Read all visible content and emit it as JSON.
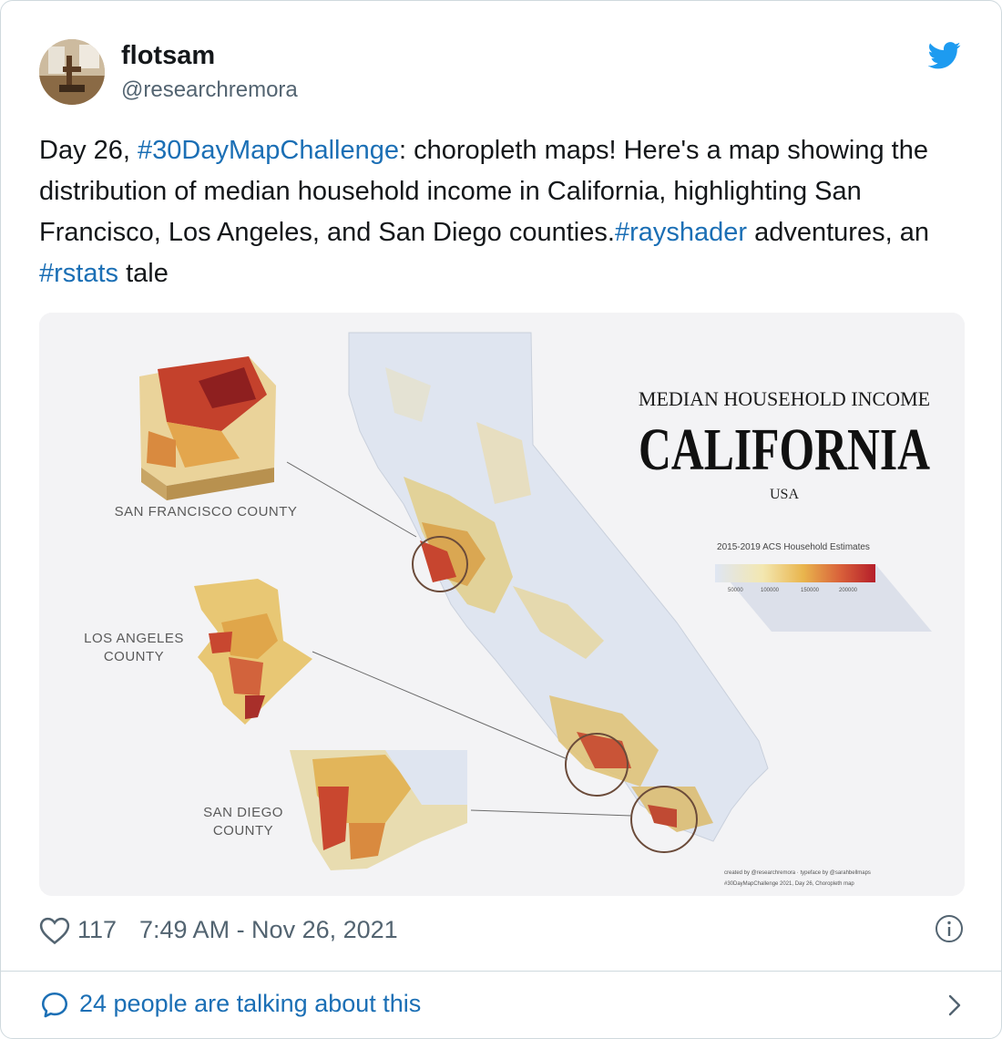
{
  "user": {
    "display_name": "flotsam",
    "handle": "@researchremora"
  },
  "tweet": {
    "segments": [
      {
        "text": "Day 26, ",
        "link": false
      },
      {
        "text": "#30DayMapChallenge",
        "link": true
      },
      {
        "text": ": choropleth maps! Here's a map showing the distribution of median household income in California, highlighting San Francisco, Los Angeles, and San Diego counties.",
        "link": false
      },
      {
        "text": "#rayshader",
        "link": true
      },
      {
        "text": " adventures, an ",
        "link": false
      },
      {
        "text": "#rstats",
        "link": true
      },
      {
        "text": " tale",
        "link": false
      }
    ]
  },
  "map": {
    "title_top": "MEDIAN HOUSEHOLD INCOME",
    "title_main": "CALIFORNIA",
    "title_sub": "USA",
    "legend_title": "2015-2019 ACS Household Estimates",
    "legend_ticks": [
      "50000",
      "100000",
      "150000",
      "200000"
    ],
    "legend_colors": [
      "#dfe6f3",
      "#f3e7b0",
      "#e9b54d",
      "#d9613a",
      "#b51e2a"
    ],
    "labels": {
      "sf": "SAN FRANCISCO COUNTY",
      "la_line1": "LOS ANGELES",
      "la_line2": "COUNTY",
      "sd_line1": "SAN DIEGO",
      "sd_line2": "COUNTY"
    },
    "credit_line1": "created by @researchremora · typeface by @sarahbellmaps",
    "credit_line2": "#30DayMapChallenge 2021, Day 26, Choropleth map"
  },
  "footer": {
    "likes": "117",
    "timestamp": "7:49 AM - Nov 26, 2021",
    "talking": "24 people are talking about this"
  },
  "colors": {
    "link": "#1b6fb5",
    "twitter_blue": "#1d9bf0",
    "muted": "#536471"
  }
}
